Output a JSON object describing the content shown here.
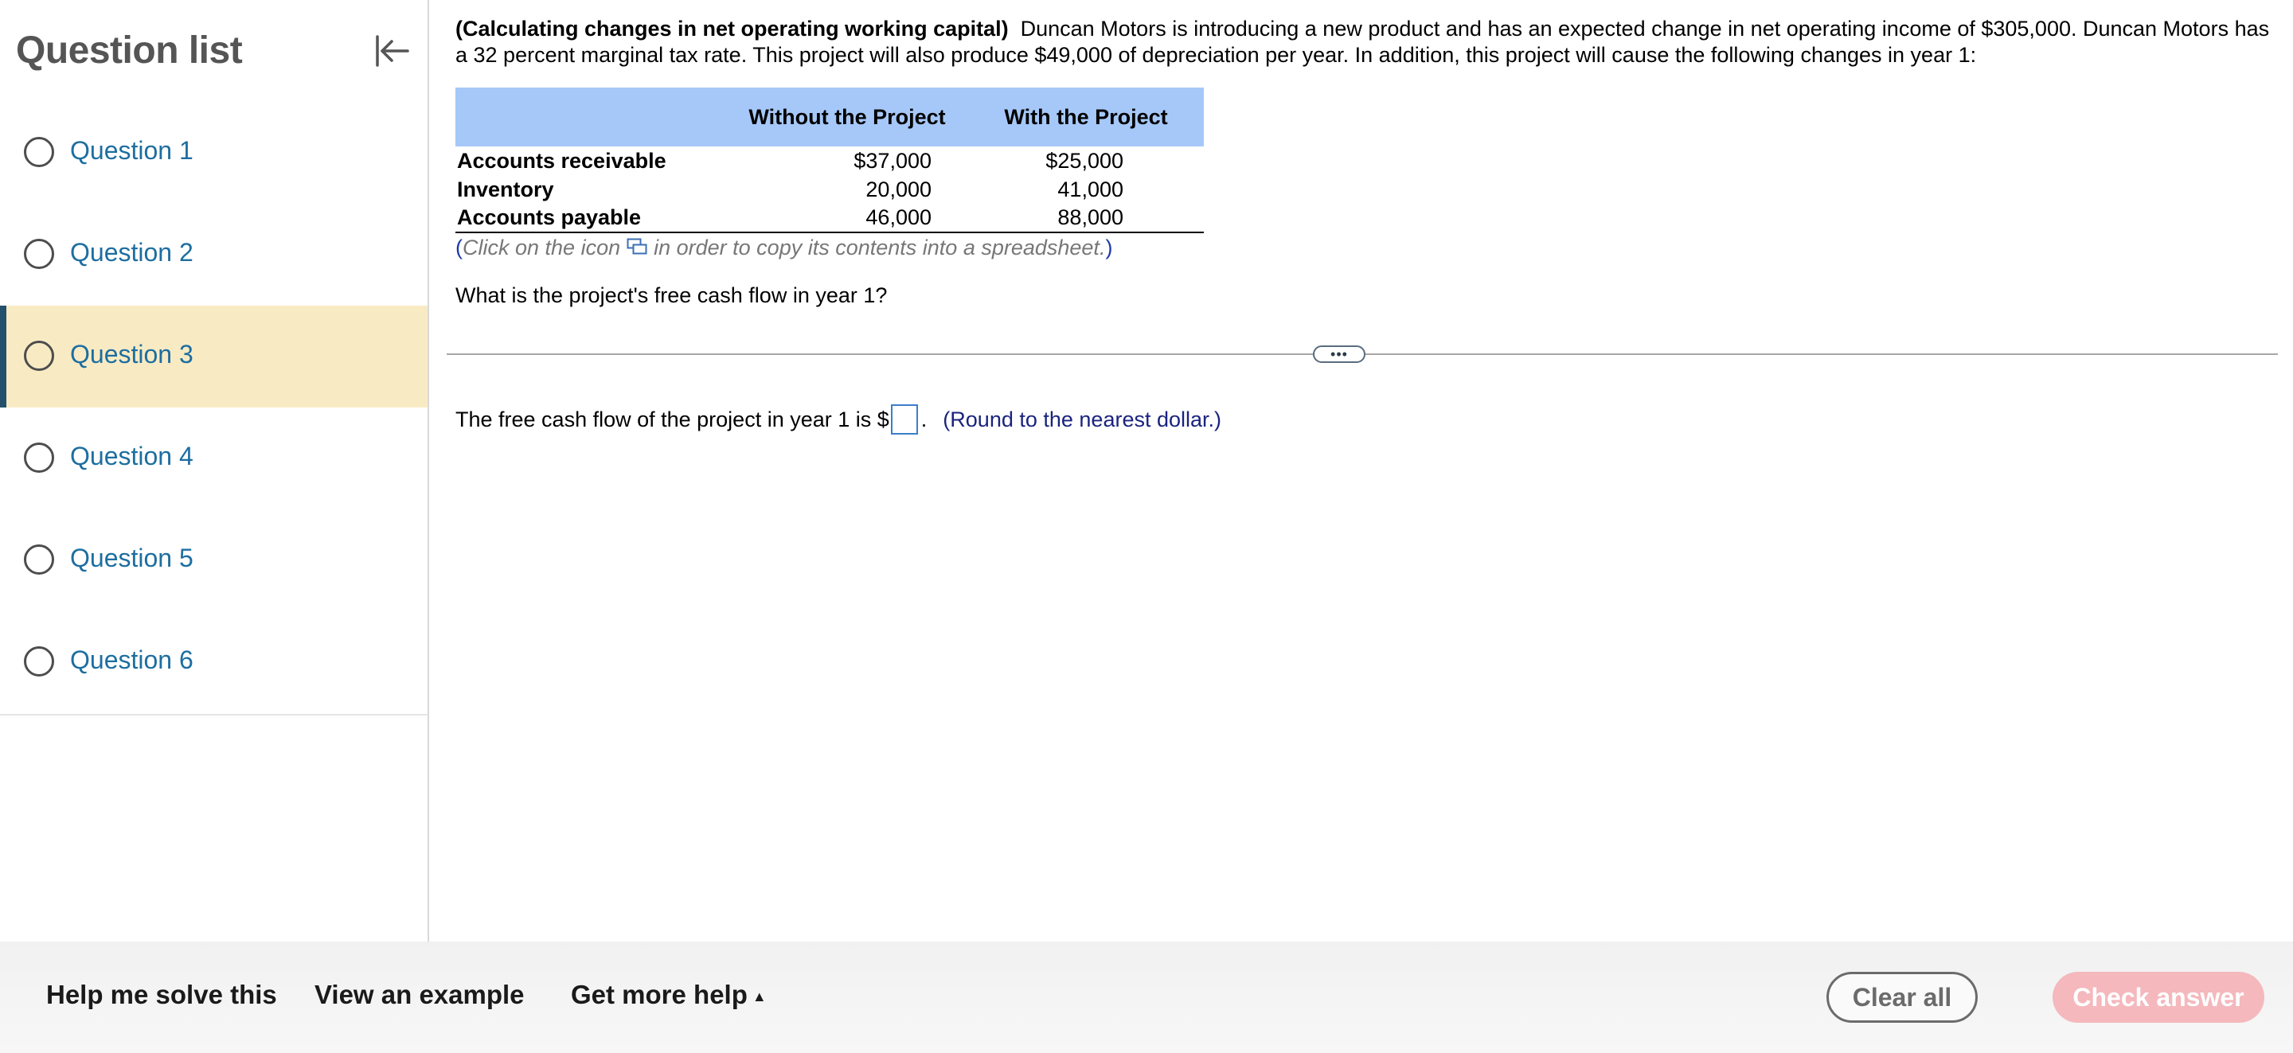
{
  "sidebar": {
    "title": "Question list",
    "questions": [
      {
        "label": "Question 1",
        "active": false
      },
      {
        "label": "Question 2",
        "active": false
      },
      {
        "label": "Question 3",
        "active": true
      },
      {
        "label": "Question 4",
        "active": false
      },
      {
        "label": "Question 5",
        "active": false
      },
      {
        "label": "Question 6",
        "active": false
      }
    ]
  },
  "problem": {
    "title": "(Calculating changes in net operating working capital)",
    "body": "Duncan Motors is introducing a new product and has an expected change in net operating income of $305,000.  Duncan Motors has a 32 percent marginal tax rate.  This project will also produce $49,000 of depreciation per year.  In addition, this project will cause the following changes in year 1:"
  },
  "table": {
    "headers": [
      "",
      "Without the Project",
      "With the Project"
    ],
    "rows": [
      [
        "Accounts receivable",
        "$37,000",
        "$25,000"
      ],
      [
        "Inventory",
        "20,000",
        "41,000"
      ],
      [
        "Accounts payable",
        "46,000",
        "88,000"
      ]
    ]
  },
  "click_note": {
    "open": "(",
    "before": "Click on the icon",
    "after": "in order to copy its contents into a spreadsheet.",
    "close": ")"
  },
  "question": "What is the project's free cash flow in year 1?",
  "divider_handle": "•••",
  "answer": {
    "prefix": "The free cash flow of the project in year 1 is $",
    "value": "",
    "suffix": ".",
    "note": "(Round to the nearest dollar.)"
  },
  "footer": {
    "help_solve": "Help me solve this",
    "view_example": "View an example",
    "more_help": "Get more help",
    "more_help_caret": "▲",
    "clear_all": "Clear all",
    "check_answer": "Check answer"
  },
  "colors": {
    "active_question_bg": "#f8ebc4",
    "question_link": "#1d6ea0",
    "table_header": "#a6c8f9",
    "check_button": "#f4b8bd"
  }
}
